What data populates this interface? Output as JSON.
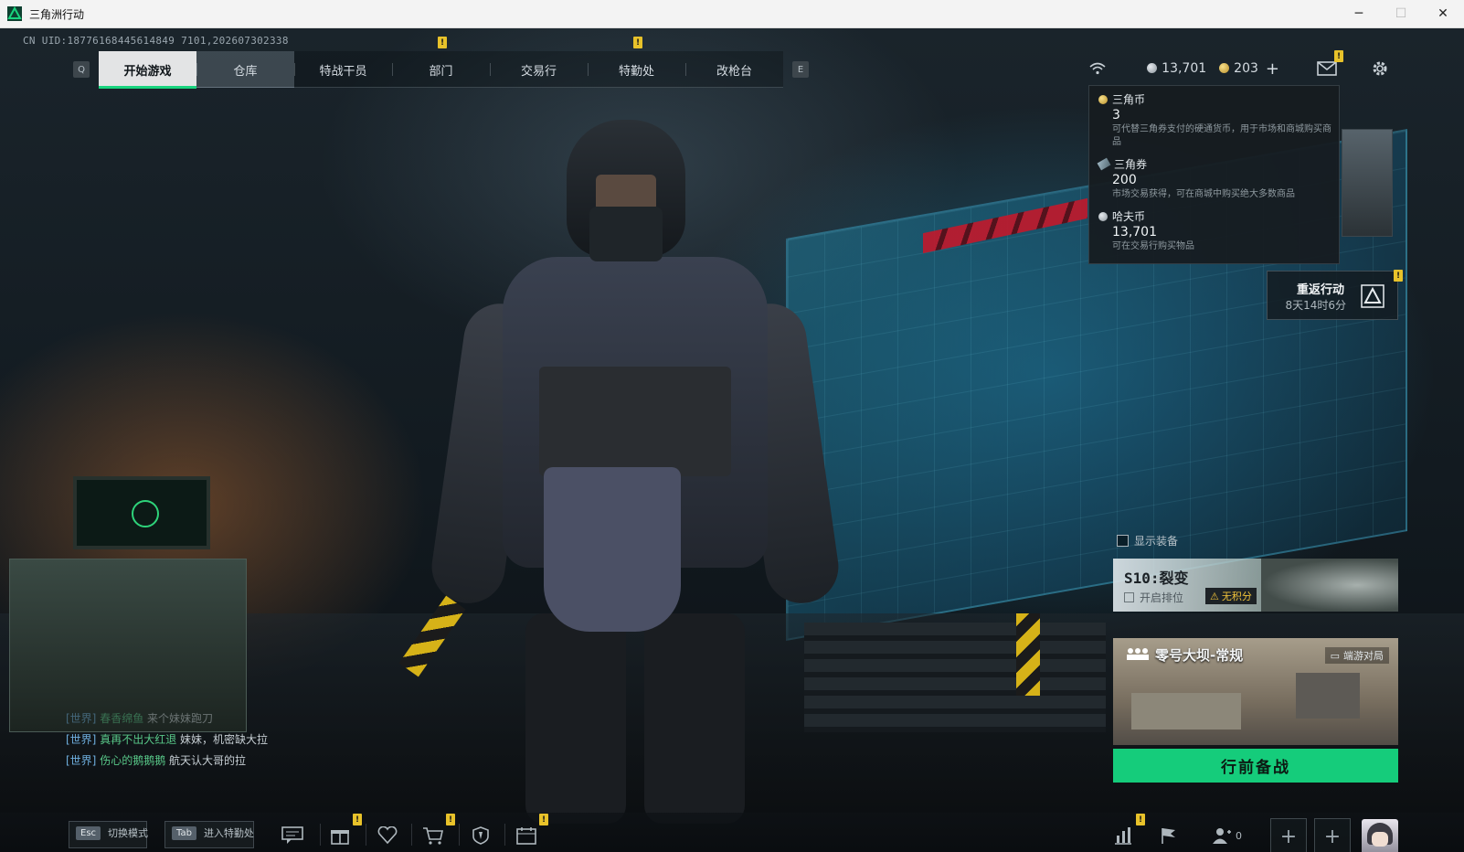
{
  "window": {
    "title": "三角洲行动",
    "minimize": "─",
    "maximize": "☐",
    "close": "✕"
  },
  "uid": "CN UID:18776168445614849 7101,202607302338",
  "nav": {
    "left_key": "Q",
    "right_key": "E",
    "tabs": [
      {
        "label": "开始游戏"
      },
      {
        "label": "仓库"
      },
      {
        "label": "特战干员"
      },
      {
        "label": "部门"
      },
      {
        "label": "交易行"
      },
      {
        "label": "特勤处"
      },
      {
        "label": "改枪台"
      }
    ],
    "badge": "!"
  },
  "top_right": {
    "haf_coin": "13,701",
    "delta_coin": "203",
    "plus": "+"
  },
  "currency_panel": {
    "items": [
      {
        "name": "三角币",
        "value": "3",
        "desc": "可代替三角券支付的硬通货币，用于市场和商城购买商品"
      },
      {
        "name": "三角券",
        "value": "200",
        "desc": "市场交易获得，可在商城中购买绝大多数商品"
      },
      {
        "name": "哈夫币",
        "value": "13,701",
        "desc": "可在交易行购买物品"
      }
    ]
  },
  "return_card": {
    "title": "重返行动",
    "time": "8天14时6分",
    "badge": "!"
  },
  "show_gear": "显示装备",
  "season_card": {
    "title": "S10:裂变",
    "rank_label": "开启排位",
    "warning": "无积分"
  },
  "map_card": {
    "title": "零号大坝-常规",
    "mode": "端游对局"
  },
  "prepare_button": "行前备战",
  "chat": [
    {
      "channel": "[世界]",
      "name": "春香绵鱼",
      "msg": "来个妹妹跑刀"
    },
    {
      "channel": "[世界]",
      "name": "真再不出大红退",
      "msg": "妹妹，机密缺大拉"
    },
    {
      "channel": "[世界]",
      "name": "伤心的鹅鹅鹅",
      "msg": "航天认大哥的拉"
    }
  ],
  "bottom": {
    "switch_key": "Esc",
    "switch_label": "切换模式",
    "tab_key": "Tab",
    "tab_label": "进入特勤处",
    "friend_count": "0",
    "badge": "!"
  },
  "colors": {
    "accent_green": "#15cc7b",
    "badge_yellow": "#e8c22a",
    "chat_channel": "#6fb0e0",
    "chat_name": "#58c788"
  }
}
